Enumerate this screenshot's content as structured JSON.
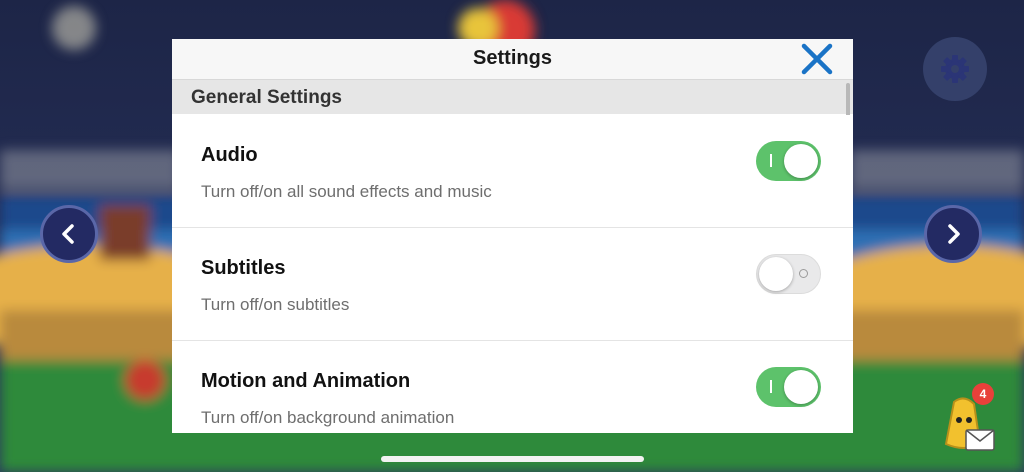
{
  "dialog": {
    "title": "Settings",
    "close_icon": "close-icon",
    "accent_color": "#1a73c6",
    "section_title": "General Settings"
  },
  "settings": [
    {
      "title": "Audio",
      "description": "Turn off/on all sound effects and music",
      "enabled": true
    },
    {
      "title": "Subtitles",
      "description": "Turn off/on subtitles",
      "enabled": false
    },
    {
      "title": "Motion and Animation",
      "description": "Turn off/on background animation",
      "enabled": true
    }
  ],
  "background": {
    "left_arrow_icon": "chevron-left-icon",
    "right_arrow_icon": "chevron-right-icon",
    "settings_icon": "gear-icon",
    "mail_icon": "envelope-icon",
    "mail_badge_count": "4",
    "toggle_on_color": "#5dc26b"
  }
}
